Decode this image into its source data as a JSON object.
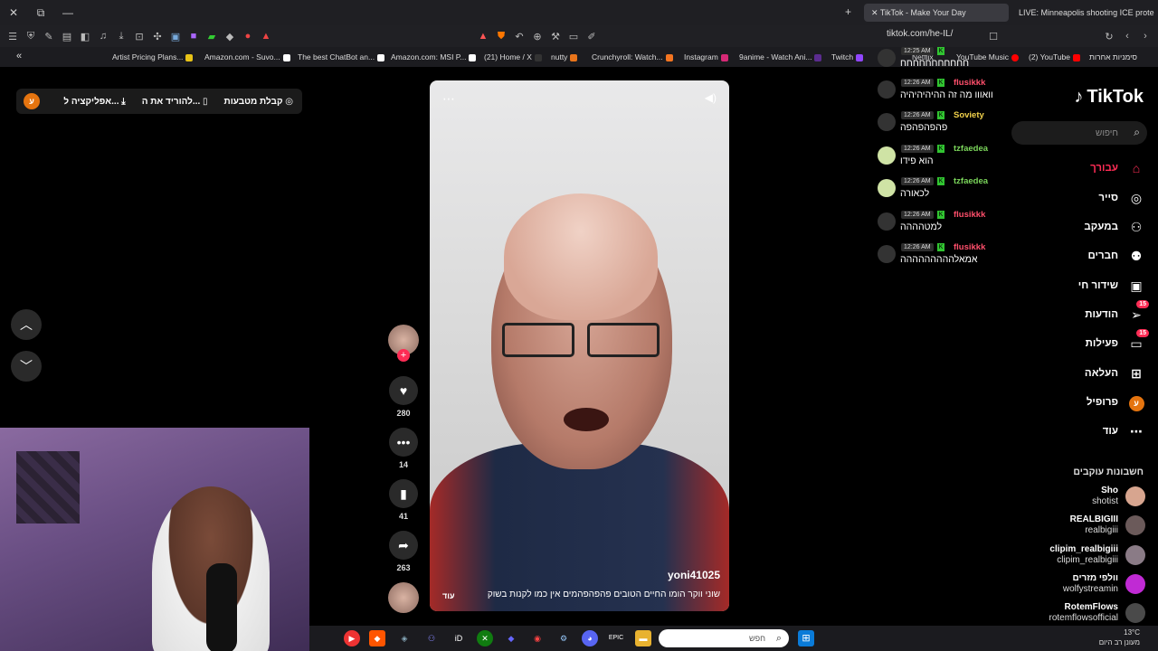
{
  "browser": {
    "tabs": [
      {
        "title": "TikTok - Make Your Day",
        "active": true
      },
      {
        "title": "LIVE: Minneapolis shooting ICE prote",
        "active": false
      }
    ],
    "url": "tiktok.com/he-IL/",
    "bookmarks": [
      {
        "label": "Artist Pricing Plans...",
        "color": "#e8c317"
      },
      {
        "label": "Amazon.com - Suvo...",
        "color": "#ffffff"
      },
      {
        "label": "The best ChatBot an...",
        "color": "#ffffff"
      },
      {
        "label": "Amazon.com: MSI P...",
        "color": "#ffffff"
      },
      {
        "label": "(21) Home / X",
        "color": "#000000"
      },
      {
        "label": "nutty",
        "color": "#e8741a"
      },
      {
        "label": "Crunchyroll: Watch...",
        "color": "#f47521"
      },
      {
        "label": "Instagram",
        "color": "#d62976"
      },
      {
        "label": "9anime - Watch Ani...",
        "color": "#5b2c8f"
      },
      {
        "label": "Twitch",
        "color": "#9146ff"
      },
      {
        "label": "Netflix",
        "color": "#e50914"
      },
      {
        "label": "YouTube Music",
        "color": "#ff0000"
      },
      {
        "label": "(2) YouTube",
        "color": "#ff0000"
      },
      {
        "label": "סימניות אחרות",
        "color": "#aaaaaa"
      }
    ]
  },
  "promo": {
    "item1": "קבלת מטבעות",
    "item2": "להוריד את ה...",
    "item3": "אפליקציה ל...",
    "avatar_letter": "ע"
  },
  "video": {
    "username": "yoni41025",
    "description": "שוני ווקר הומו החיים הטובים פהפהפהמים אין כמו לקנות בשוק",
    "more_label": "עוד",
    "likes": "280",
    "comments": "14",
    "saves": "41",
    "shares": "263"
  },
  "chat": [
    {
      "time": "12:25 AM",
      "name": "",
      "text": "חחחחחחחחחחח",
      "color": "#ffffff"
    },
    {
      "time": "12:26 AM",
      "name": "flusikkk",
      "text": "וואווו מה זה ההיהיהיהיה",
      "color": "#ff4f6b"
    },
    {
      "time": "12:26 AM",
      "name": "Soviety",
      "text": "פהפהפהפה",
      "color": "#f2d24b"
    },
    {
      "time": "12:26 AM",
      "name": "tzfaedea",
      "text": "הוא פידו",
      "color": "#7bd65b"
    },
    {
      "time": "12:26 AM",
      "name": "tzfaedea",
      "text": "לכאורה",
      "color": "#7bd65b"
    },
    {
      "time": "12:26 AM",
      "name": "flusikkk",
      "text": "למטהההה",
      "color": "#ff4f6b"
    },
    {
      "time": "12:26 AM",
      "name": "flusikkk",
      "text": "אמאלההההההההה",
      "color": "#ff4f6b"
    }
  ],
  "sidebar": {
    "logo": "TikTok",
    "search_placeholder": "חיפוש",
    "nav": [
      {
        "label": "עבורך",
        "icon": "home-icon"
      },
      {
        "label": "סייר",
        "icon": "compass-icon"
      },
      {
        "label": "במעקב",
        "icon": "following-icon"
      },
      {
        "label": "חברים",
        "icon": "friends-icon"
      },
      {
        "label": "שידור חי",
        "icon": "live-icon"
      },
      {
        "label": "הודעות",
        "icon": "messages-icon",
        "badge": "15"
      },
      {
        "label": "פעילות",
        "icon": "activity-icon",
        "badge": "15"
      },
      {
        "label": "העלאה",
        "icon": "upload-icon"
      },
      {
        "label": "פרופיל",
        "icon": "profile-icon"
      },
      {
        "label": "עוד",
        "icon": "more-icon"
      }
    ],
    "following_title": "חשבונות עוקבים",
    "accounts": [
      {
        "display": "Sho",
        "handle": "shotist",
        "color": "#d7a58f"
      },
      {
        "display": "REALBIGIII",
        "handle": "realbigiii",
        "color": "#6b5a5a"
      },
      {
        "display": "clipim_realbigiii",
        "handle": "clipim_realbigiii",
        "color": "#8a7b86"
      },
      {
        "display": "וולפי מזרים",
        "handle": "wolfystreamin",
        "color": "#c02ad4"
      },
      {
        "display": "RotemFlows",
        "handle": "rotemflowsofficial",
        "color": "#4a4a4a"
      }
    ]
  },
  "taskbar": {
    "search_placeholder": "חפש",
    "weather_temp": "13°C",
    "weather_desc": "מעונן רב היום"
  }
}
